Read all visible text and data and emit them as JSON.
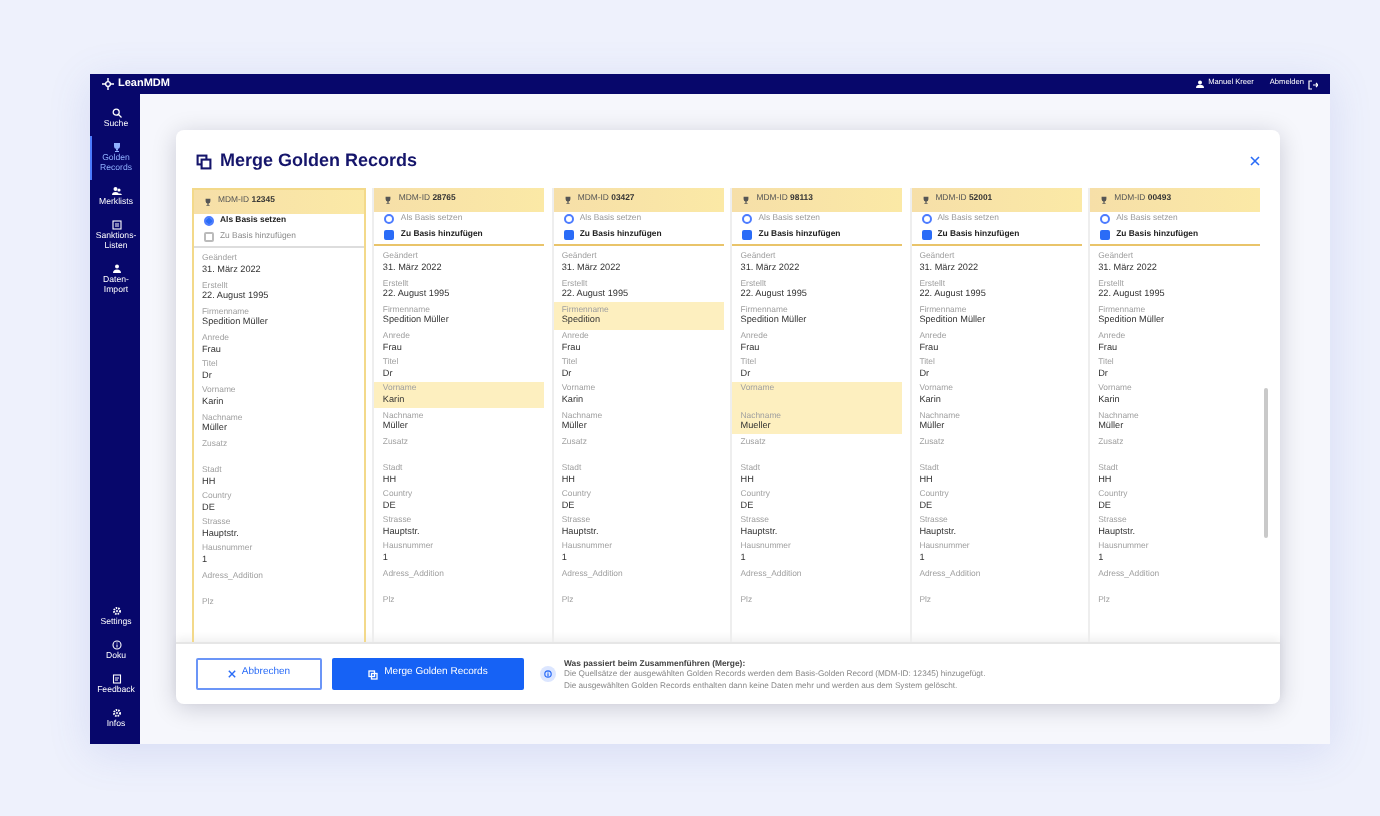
{
  "app": {
    "logo": "LeanMDM",
    "user": "Manuel Kreer",
    "logout": "Abmelden"
  },
  "sidebar": {
    "items": [
      {
        "label": "Suche",
        "selected": false
      },
      {
        "label": "Golden Records",
        "selected": true
      },
      {
        "label": "Merklists",
        "selected": false
      },
      {
        "label": "Sanktions-Listen",
        "selected": false
      },
      {
        "label": "Daten-Import",
        "selected": false
      }
    ],
    "bottom_items": [
      {
        "label": "Settings",
        "selected": false
      },
      {
        "label": "Doku",
        "selected": false
      },
      {
        "label": "Feedback",
        "selected": false
      },
      {
        "label": "Infos",
        "selected": false
      }
    ]
  },
  "modal": {
    "title": "Merge Golden Records",
    "columns": [
      {
        "id_label": "MDM-ID",
        "id": "12345",
        "base_label": "Als Basis setzen",
        "base_selected": true,
        "add_label": "Zu Basis hinzufügen",
        "add_checked": false,
        "add_disabled": true,
        "fields": [
          {
            "label": "Geändert",
            "value": "31. März 2022",
            "highlighted": false
          },
          {
            "label": "Erstellt",
            "value": "22. August 1995",
            "highlighted": false
          },
          {
            "label": "Firmenname",
            "value": "Spedition Müller",
            "highlighted": false
          },
          {
            "label": "Anrede",
            "value": "Frau",
            "highlighted": false
          },
          {
            "label": "Titel",
            "value": "Dr",
            "highlighted": false
          },
          {
            "label": "Vorname",
            "value": "Karin",
            "highlighted": false
          },
          {
            "label": "Nachname",
            "value": "Müller",
            "highlighted": false
          },
          {
            "label": "Zusatz",
            "highlighted": false
          },
          {
            "label": "Stadt",
            "value": "HH",
            "highlighted": false
          },
          {
            "label": "Country",
            "value": "DE",
            "highlighted": false
          },
          {
            "label": "Strasse",
            "value": "Hauptstr.",
            "highlighted": false
          },
          {
            "label": "Hausnummer",
            "value": "1",
            "highlighted": false
          },
          {
            "label": "Adress_Addition",
            "highlighted": false
          },
          {
            "label": "Plz",
            "highlighted": false
          }
        ]
      },
      {
        "id_label": "MDM-ID",
        "id": "28765",
        "base_label": "Als Basis setzen",
        "base_selected": false,
        "add_label": "Zu Basis hinzufügen",
        "add_checked": true,
        "add_disabled": false,
        "fields": [
          {
            "label": "Geändert",
            "value": "31. März 2022",
            "highlighted": false
          },
          {
            "label": "Erstellt",
            "value": "22. August 1995",
            "highlighted": false
          },
          {
            "label": "Firmenname",
            "value": "Spedition Müller",
            "highlighted": false
          },
          {
            "label": "Anrede",
            "value": "Frau",
            "highlighted": false
          },
          {
            "label": "Titel",
            "value": "Dr",
            "highlighted": false
          },
          {
            "label": "Vorname",
            "value": "Karin",
            "highlighted": true
          },
          {
            "label": "Nachname",
            "value": "Müller",
            "highlighted": false
          },
          {
            "label": "Zusatz",
            "highlighted": false
          },
          {
            "label": "Stadt",
            "value": "HH",
            "highlighted": false
          },
          {
            "label": "Country",
            "value": "DE",
            "highlighted": false
          },
          {
            "label": "Strasse",
            "value": "Hauptstr.",
            "highlighted": false
          },
          {
            "label": "Hausnummer",
            "value": "1",
            "highlighted": false
          },
          {
            "label": "Adress_Addition",
            "highlighted": false
          },
          {
            "label": "Plz",
            "highlighted": false
          }
        ]
      },
      {
        "id_label": "MDM-ID",
        "id": "03427",
        "base_label": "Als Basis setzen",
        "base_selected": false,
        "add_label": "Zu Basis hinzufügen",
        "add_checked": true,
        "add_disabled": false,
        "fields": [
          {
            "label": "Geändert",
            "value": "31. März 2022",
            "highlighted": false
          },
          {
            "label": "Erstellt",
            "value": "22. August 1995",
            "highlighted": false
          },
          {
            "label": "Firmenname",
            "value": "Spedition",
            "highlighted": true
          },
          {
            "label": "Anrede",
            "value": "Frau",
            "highlighted": false
          },
          {
            "label": "Titel",
            "value": "Dr",
            "highlighted": false
          },
          {
            "label": "Vorname",
            "value": "Karin",
            "highlighted": false
          },
          {
            "label": "Nachname",
            "value": "Müller",
            "highlighted": false
          },
          {
            "label": "Zusatz",
            "highlighted": false
          },
          {
            "label": "Stadt",
            "value": "HH",
            "highlighted": false
          },
          {
            "label": "Country",
            "value": "DE",
            "highlighted": false
          },
          {
            "label": "Strasse",
            "value": "Hauptstr.",
            "highlighted": false
          },
          {
            "label": "Hausnummer",
            "value": "1",
            "highlighted": false
          },
          {
            "label": "Adress_Addition",
            "highlighted": false
          },
          {
            "label": "Plz",
            "highlighted": false
          }
        ]
      },
      {
        "id_label": "MDM-ID",
        "id": "98113",
        "base_label": "Als Basis setzen",
        "base_selected": false,
        "add_label": "Zu Basis hinzufügen",
        "add_checked": true,
        "add_disabled": false,
        "fields": [
          {
            "label": "Geändert",
            "value": "31. März 2022",
            "highlighted": false
          },
          {
            "label": "Erstellt",
            "value": "22. August 1995",
            "highlighted": false
          },
          {
            "label": "Firmenname",
            "value": "Spedition Müller",
            "highlighted": false
          },
          {
            "label": "Anrede",
            "value": "Frau",
            "highlighted": false
          },
          {
            "label": "Titel",
            "value": "Dr",
            "highlighted": false
          },
          {
            "label": "Vorname",
            "highlighted": true
          },
          {
            "label": "Nachname",
            "value": "Mueller",
            "highlighted": true
          },
          {
            "label": "Zusatz",
            "highlighted": false
          },
          {
            "label": "Stadt",
            "value": "HH",
            "highlighted": false
          },
          {
            "label": "Country",
            "value": "DE",
            "highlighted": false
          },
          {
            "label": "Strasse",
            "value": "Hauptstr.",
            "highlighted": false
          },
          {
            "label": "Hausnummer",
            "value": "1",
            "highlighted": false
          },
          {
            "label": "Adress_Addition",
            "highlighted": false
          },
          {
            "label": "Plz",
            "highlighted": false
          }
        ]
      },
      {
        "id_label": "MDM-ID",
        "id": "52001",
        "base_label": "Als Basis setzen",
        "base_selected": false,
        "add_label": "Zu Basis hinzufügen",
        "add_checked": true,
        "add_disabled": false,
        "fields": [
          {
            "label": "Geändert",
            "value": "31. März 2022",
            "highlighted": false
          },
          {
            "label": "Erstellt",
            "value": "22. August 1995",
            "highlighted": false
          },
          {
            "label": "Firmenname",
            "value": "Spedition Müller",
            "highlighted": false
          },
          {
            "label": "Anrede",
            "value": "Frau",
            "highlighted": false
          },
          {
            "label": "Titel",
            "value": "Dr",
            "highlighted": false
          },
          {
            "label": "Vorname",
            "value": "Karin",
            "highlighted": false
          },
          {
            "label": "Nachname",
            "value": "Müller",
            "highlighted": false
          },
          {
            "label": "Zusatz",
            "highlighted": false
          },
          {
            "label": "Stadt",
            "value": "HH",
            "highlighted": false
          },
          {
            "label": "Country",
            "value": "DE",
            "highlighted": false
          },
          {
            "label": "Strasse",
            "value": "Hauptstr.",
            "highlighted": false
          },
          {
            "label": "Hausnummer",
            "value": "1",
            "highlighted": false
          },
          {
            "label": "Adress_Addition",
            "highlighted": false
          },
          {
            "label": "Plz",
            "highlighted": false
          }
        ]
      },
      {
        "id_label": "MDM-ID",
        "id": "00493",
        "base_label": "Als Basis setzen",
        "base_selected": false,
        "add_label": "Zu Basis hinzufügen",
        "add_checked": true,
        "add_disabled": false,
        "fields": [
          {
            "label": "Geändert",
            "value": "31. März 2022",
            "highlighted": false
          },
          {
            "label": "Erstellt",
            "value": "22. August 1995",
            "highlighted": false
          },
          {
            "label": "Firmenname",
            "value": "Spedition Müller",
            "highlighted": false
          },
          {
            "label": "Anrede",
            "value": "Frau",
            "highlighted": false
          },
          {
            "label": "Titel",
            "value": "Dr",
            "highlighted": false
          },
          {
            "label": "Vorname",
            "value": "Karin",
            "highlighted": false
          },
          {
            "label": "Nachname",
            "value": "Müller",
            "highlighted": false
          },
          {
            "label": "Zusatz",
            "highlighted": false
          },
          {
            "label": "Stadt",
            "value": "HH",
            "highlighted": false
          },
          {
            "label": "Country",
            "value": "DE",
            "highlighted": false
          },
          {
            "label": "Strasse",
            "value": "Hauptstr.",
            "highlighted": false
          },
          {
            "label": "Hausnummer",
            "value": "1",
            "highlighted": false
          },
          {
            "label": "Adress_Addition",
            "highlighted": false
          },
          {
            "label": "Plz",
            "highlighted": false
          }
        ]
      }
    ],
    "cancel_button": "Abbrechen",
    "merge_button": "Merge Golden Records",
    "info": {
      "title": "Was passiert beim Zusammenführen (Merge):",
      "lines": [
        "Die Quellsätze der ausgewählten Golden Records werden dem Basis-Golden Record (MDM-ID: 12345) hinzugefügt.",
        "Die ausgewählten Golden Records enthalten dann keine Daten mehr und werden aus dem System gelöscht."
      ]
    }
  }
}
